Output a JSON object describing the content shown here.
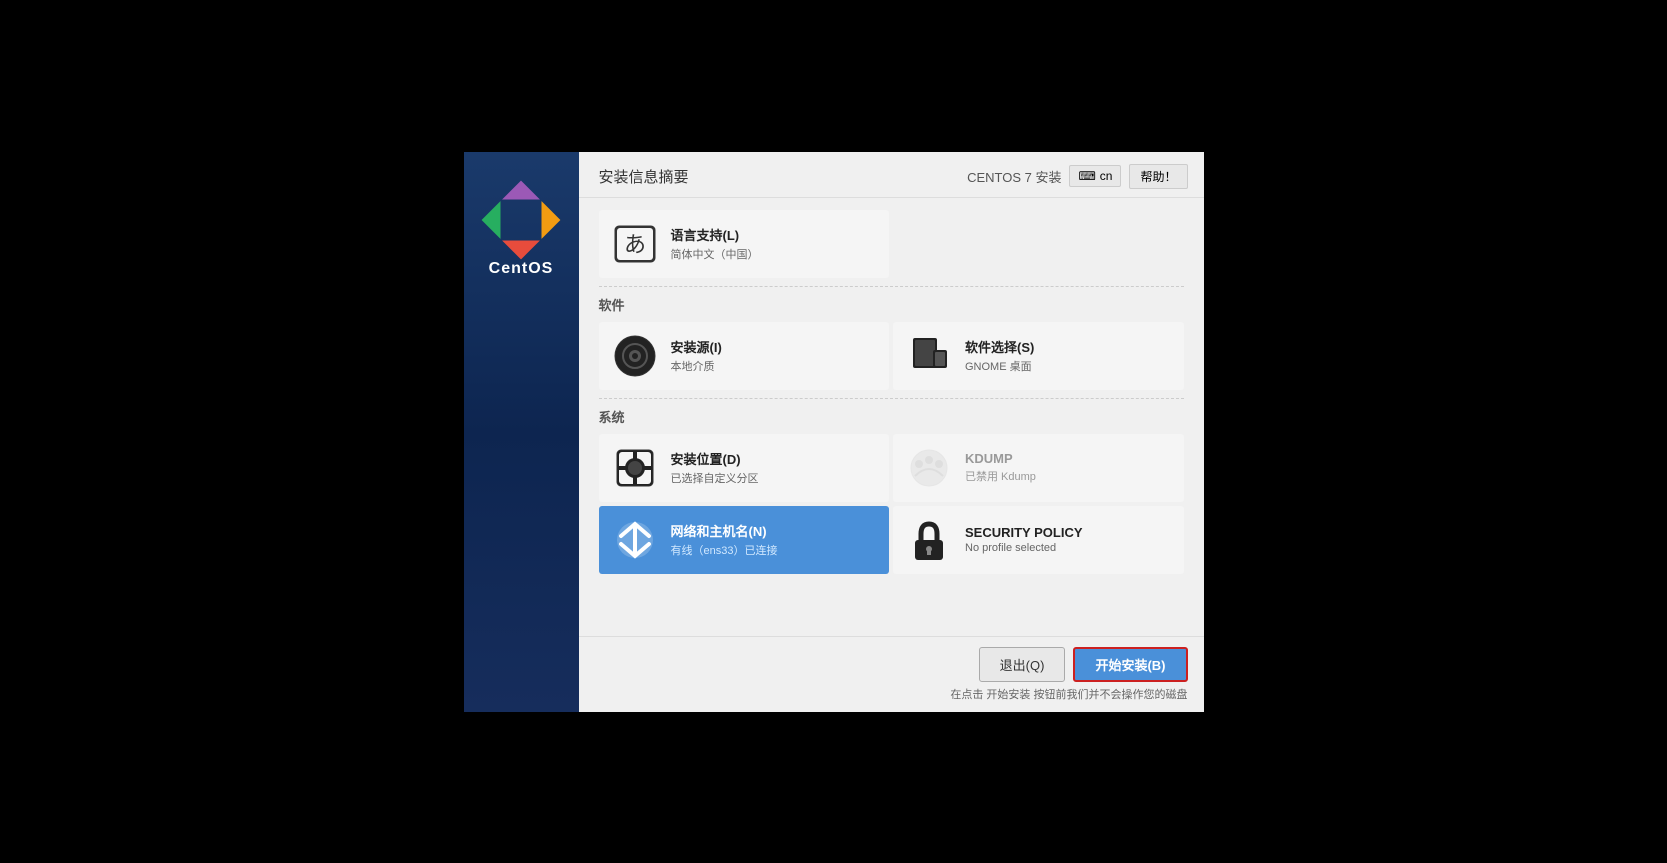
{
  "header": {
    "title": "安装信息摘要",
    "install_label": "CENTOS 7 安装",
    "lang_code": "cn",
    "help_label": "帮助！"
  },
  "sidebar": {
    "brand": "CentOS"
  },
  "sections": [
    {
      "id": "localization",
      "items": [
        {
          "id": "lang",
          "title": "语言支持(L)",
          "subtitle": "简体中文（中国）",
          "icon": "lang-icon",
          "active": false,
          "dimmed": false
        }
      ]
    },
    {
      "id": "software",
      "label": "软件",
      "items": [
        {
          "id": "source",
          "title": "安装源(I)",
          "subtitle": "本地介质",
          "icon": "source-icon",
          "active": false,
          "dimmed": false
        },
        {
          "id": "software-selection",
          "title": "软件选择(S)",
          "subtitle": "GNOME 桌面",
          "icon": "software-icon",
          "active": false,
          "dimmed": false
        }
      ]
    },
    {
      "id": "system",
      "label": "系统",
      "items": [
        {
          "id": "disk",
          "title": "安装位置(D)",
          "subtitle": "已选择自定义分区",
          "icon": "disk-icon",
          "active": false,
          "dimmed": false
        },
        {
          "id": "kdump",
          "title": "KDUMP",
          "subtitle": "已禁用 Kdump",
          "icon": "kdump-icon",
          "active": false,
          "dimmed": true
        },
        {
          "id": "network",
          "title": "网络和主机名(N)",
          "subtitle": "有线（ens33）已连接",
          "icon": "network-icon",
          "active": true,
          "dimmed": false
        },
        {
          "id": "security",
          "title": "SECURITY POLICY",
          "subtitle": "No profile selected",
          "icon": "security-icon",
          "active": false,
          "dimmed": false
        }
      ]
    }
  ],
  "footer": {
    "quit_label": "退出(Q)",
    "install_label": "开始安装(B)",
    "note": "在点击 开始安装 按钮前我们并不会操作您的磁盘"
  }
}
